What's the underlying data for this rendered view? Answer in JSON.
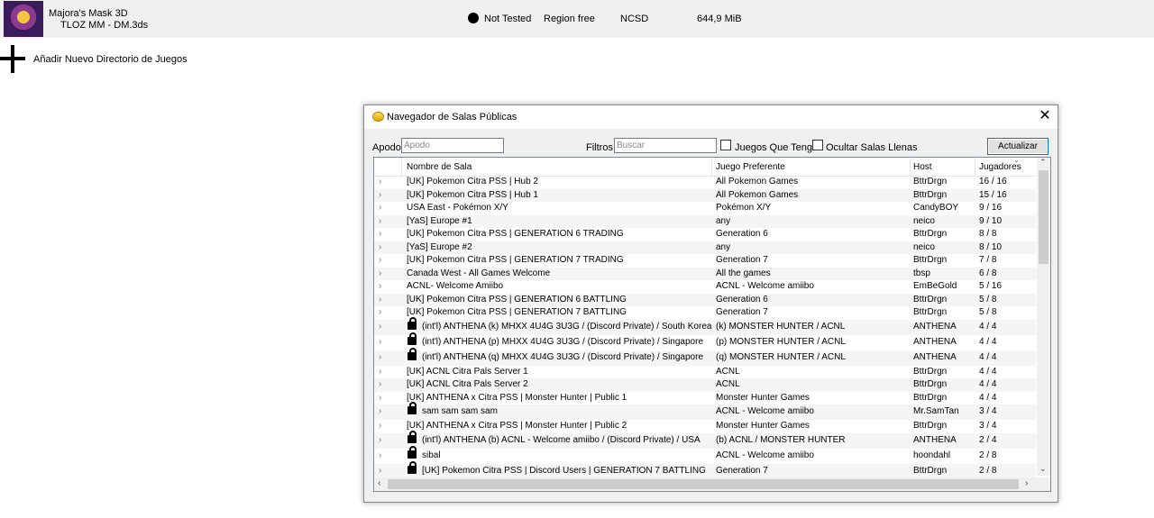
{
  "game_list": {
    "title": "Majora's Mask 3D",
    "file": "TLOZ MM - DM.3ds",
    "compatibility": "Not Tested",
    "region": "Region free",
    "file_type": "NCSD",
    "size": "644,9 MiB"
  },
  "add_directory": {
    "label": "Añadir Nuevo Directorio de Juegos"
  },
  "dialog": {
    "title": "Navegador de Salas Públicas",
    "nickname_label": "Apodo",
    "nickname_placeholder": "Apodo",
    "filters_label": "Filtros",
    "search_placeholder": "Buscar",
    "owned_games_label": "Juegos Que Tengo",
    "hide_full_label": "Ocultar Salas Llenas",
    "refresh_label": "Actualizar Lista",
    "columns": {
      "room_name": "Nombre de Sala",
      "preferred_game": "Juego Preferente",
      "host": "Host",
      "players": "Jugadores"
    },
    "rooms": [
      {
        "name": "[UK] Pokemon Citra PSS | Hub 2",
        "game": "All Pokemon Games",
        "host": "BttrDrgn",
        "players": "16 / 16",
        "locked": false
      },
      {
        "name": "[UK] Pokemon Citra PSS | Hub 1",
        "game": "All Pokemon Games",
        "host": "BttrDrgn",
        "players": "15 / 16",
        "locked": false
      },
      {
        "name": "USA East - Pokémon X/Y",
        "game": "Pokémon X/Y",
        "host": "CandyBOY",
        "players": "9 / 16",
        "locked": false
      },
      {
        "name": "[YaS] Europe #1",
        "game": "any",
        "host": "neico",
        "players": "9 / 10",
        "locked": false
      },
      {
        "name": "[UK] Pokemon Citra PSS | GENERATION 6 TRADING",
        "game": "Generation 6",
        "host": "BttrDrgn",
        "players": "8 / 8",
        "locked": false
      },
      {
        "name": "[YaS] Europe #2",
        "game": "any",
        "host": "neico",
        "players": "8 / 10",
        "locked": false
      },
      {
        "name": "[UK] Pokemon Citra PSS | GENERATION 7 TRADING",
        "game": "Generation 7",
        "host": "BttrDrgn",
        "players": "7 / 8",
        "locked": false
      },
      {
        "name": "Canada West - All Games Welcome",
        "game": "All the games",
        "host": "tbsp",
        "players": "6 / 8",
        "locked": false
      },
      {
        "name": "ACNL- Welcome Amiibo",
        "game": "ACNL - Welcome amiibo",
        "host": "EmBeGold",
        "players": "5 / 16",
        "locked": false
      },
      {
        "name": "[UK] Pokemon Citra PSS | GENERATION 6 BATTLING",
        "game": "Generation 6",
        "host": "BttrDrgn",
        "players": "5 / 8",
        "locked": false
      },
      {
        "name": "[UK] Pokemon Citra PSS | GENERATION 7 BATTLING",
        "game": "Generation 7",
        "host": "BttrDrgn",
        "players": "5 / 8",
        "locked": false
      },
      {
        "name": "(int'l) ANTHENA (k) MHXX 4U4G 3U3G / (Discord Private) / South Korea",
        "game": "(k) MONSTER HUNTER / ACNL",
        "host": "ANTHENA",
        "players": "4 / 4",
        "locked": true
      },
      {
        "name": "(int'l) ANTHENA (p) MHXX 4U4G 3U3G / (Discord Private) / Singapore",
        "game": "(p) MONSTER HUNTER / ACNL",
        "host": "ANTHENA",
        "players": "4 / 4",
        "locked": true
      },
      {
        "name": "(int'l) ANTHENA (q) MHXX 4U4G 3U3G / (Discord Private) / Singapore",
        "game": "(q) MONSTER HUNTER / ACNL",
        "host": "ANTHENA",
        "players": "4 / 4",
        "locked": true
      },
      {
        "name": "[UK] ACNL Citra Pals Server 1",
        "game": "ACNL",
        "host": "BttrDrgn",
        "players": "4 / 4",
        "locked": false
      },
      {
        "name": "[UK] ACNL Citra Pals Server 2",
        "game": "ACNL",
        "host": "BttrDrgn",
        "players": "4 / 4",
        "locked": false
      },
      {
        "name": "[UK] ANTHENA x Citra PSS | Monster Hunter | Public 1",
        "game": "Monster Hunter Games",
        "host": "BttrDrgn",
        "players": "4 / 4",
        "locked": false
      },
      {
        "name": "sam sam sam sam",
        "game": "ACNL - Welcome amiibo",
        "host": "Mr.SamTan",
        "players": "3 / 4",
        "locked": true
      },
      {
        "name": "[UK] ANTHENA x Citra PSS | Monster Hunter | Public 2",
        "game": "Monster Hunter Games",
        "host": "BttrDrgn",
        "players": "3 / 4",
        "locked": false
      },
      {
        "name": "(int'l) ANTHENA (b) ACNL - Welcome amiibo / (Discord Private) / USA",
        "game": "(b) ACNL / MONSTER HUNTER",
        "host": "ANTHENA",
        "players": "2 / 4",
        "locked": true
      },
      {
        "name": "sibal",
        "game": "ACNL - Welcome amiibo",
        "host": "hoondahl",
        "players": "2 / 8",
        "locked": true
      },
      {
        "name": "[UK] Pokemon Citra PSS | Discord Users | GENERATION 7 BATTLING",
        "game": "Generation 7",
        "host": "BttrDrgn",
        "players": "2 / 8",
        "locked": true
      }
    ]
  },
  "icons": {
    "compat": "black-circle-icon",
    "add": "plus-icon",
    "dialog": "yellow-blob-icon",
    "close": "close-icon",
    "lock": "lock-icon",
    "expand": "chevron-right-icon"
  }
}
